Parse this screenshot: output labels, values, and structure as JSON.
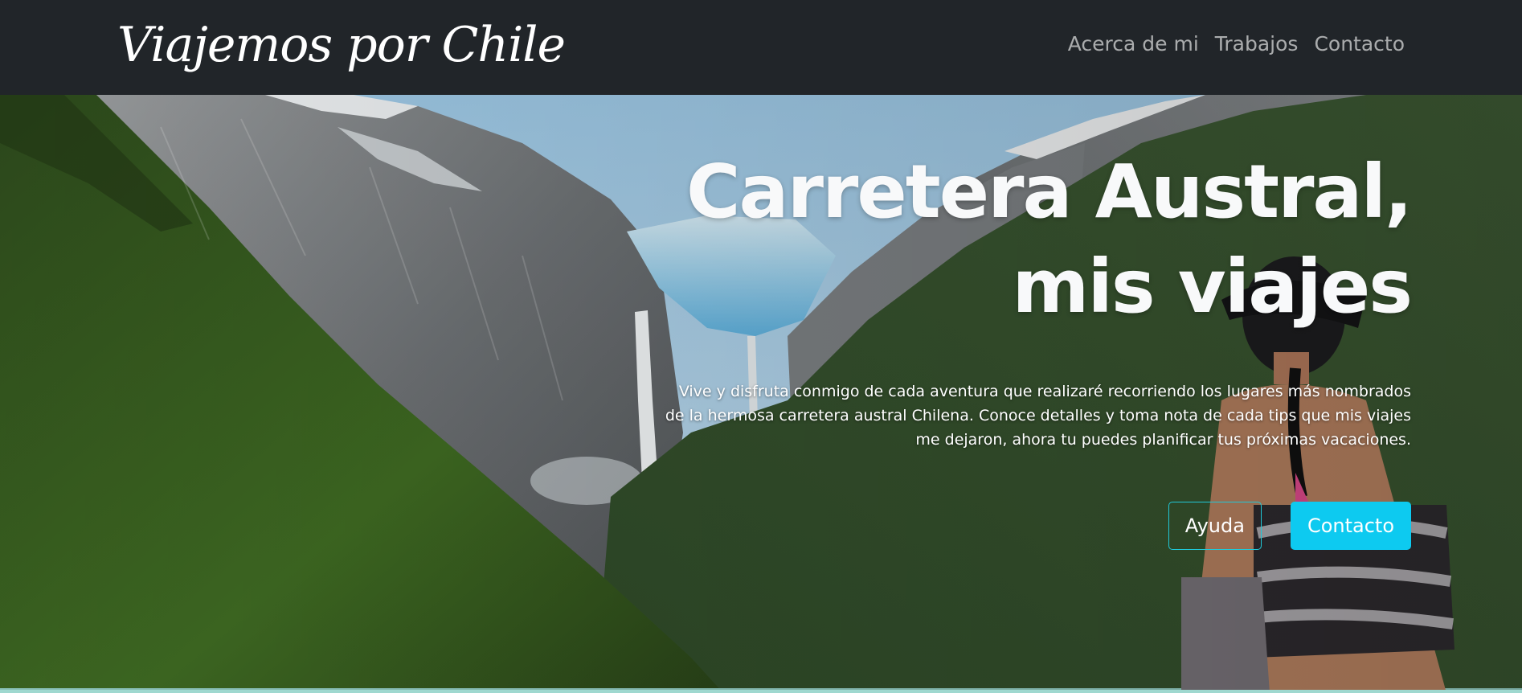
{
  "navbar": {
    "brand": "Viajemos por Chile",
    "links": [
      "Acerca de mi",
      "Trabajos",
      "Contacto"
    ]
  },
  "hero": {
    "title_line1": "Carretera Austral,",
    "title_line2": "mis viajes",
    "description": "Vive y disfruta conmigo de cada aventura que realizaré recorriendo los lugares más nombrados de la hermosa carretera austral Chilena. Conoce detalles y toma nota de cada tips que mis viajes me dejaron, ahora tu puedes planificar tus próximas vacaciones.",
    "buttons": {
      "help": "Ayuda",
      "contact": "Contacto"
    }
  },
  "colors": {
    "navbar_bg": "#212529",
    "accent": "#0dcaf0",
    "outline_border": "#20c9d8"
  }
}
